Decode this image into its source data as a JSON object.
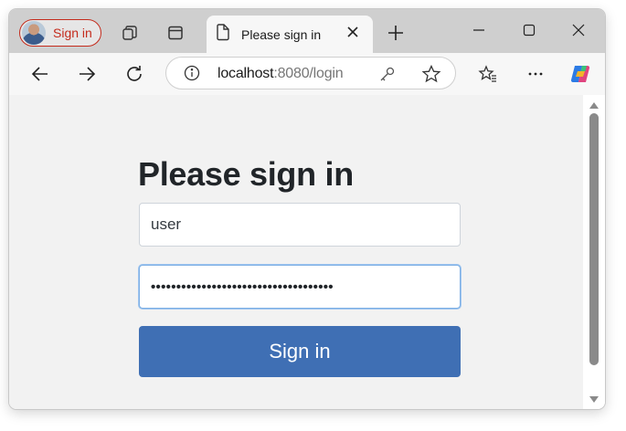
{
  "browser": {
    "profile_label": "Sign in",
    "tab_title": "Please sign in",
    "address_host": "localhost",
    "address_rest": ":8080/login"
  },
  "icons": [
    "avatar",
    "workspaces-icon",
    "tab-actions-icon",
    "document-icon",
    "close-icon",
    "new-tab-icon",
    "minimize-icon",
    "maximize-icon",
    "close-window-icon",
    "back-icon",
    "forward-icon",
    "refresh-icon",
    "site-info-icon",
    "key-icon",
    "star-icon",
    "favorites-icon",
    "more-icon",
    "copilot-icon"
  ],
  "colors": {
    "profile_accent": "#c42b1c",
    "button_primary": "#3f6fb4",
    "page_background": "#f2f2f2"
  },
  "login": {
    "heading": "Please sign in",
    "username_value": "user",
    "password_mask": "••••••••••••••••••••••••••••••••••••",
    "submit_label": "Sign in"
  }
}
